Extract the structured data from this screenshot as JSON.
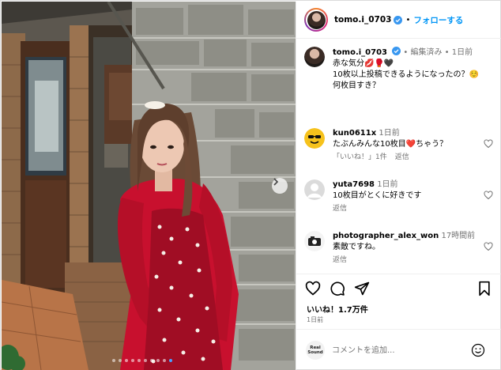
{
  "header": {
    "username": "tomo.i_0703",
    "separator": "•",
    "follow_label": "フォローする"
  },
  "caption": {
    "username": "tomo.i_0703",
    "meta": "• 編集済み • 1日前",
    "lines": [
      "赤な気分💋🥊🖤",
      "",
      "10枚以上投稿できるようになったの？☺️",
      "",
      "何枚目すき？"
    ]
  },
  "comments": [
    {
      "username": "kun0611x",
      "time": "1日前",
      "text": "たぶんみんな10枚目❤️ちゃう？",
      "likes": "「いいね！」1件",
      "reply_label": "返信",
      "avatar_icon": "sunglasses-smiley-icon"
    },
    {
      "username": "yuta7698",
      "time": "1日前",
      "text": "10枚目がとくに好きです",
      "likes": "",
      "reply_label": "返信",
      "avatar_icon": "default-avatar-icon"
    },
    {
      "username": "photographer_alex_won",
      "time": "17時間前",
      "text": "素敵ですね。",
      "likes": "",
      "reply_label": "返信",
      "avatar_icon": "camera-drawing-icon"
    }
  ],
  "actions": {
    "likes_label": "いいね！1.7万件",
    "date_label": "1日前"
  },
  "add_comment": {
    "logo_text_1": "Real",
    "logo_text_2": "Sound",
    "placeholder": "コメントを追加..."
  },
  "carousel": {
    "dot_count": 10,
    "active_index": 9
  },
  "colors": {
    "follow_blue": "#0095f6",
    "verified_blue": "#3897f0",
    "meta_grey": "#737373",
    "dress_red": "#c8102e"
  }
}
